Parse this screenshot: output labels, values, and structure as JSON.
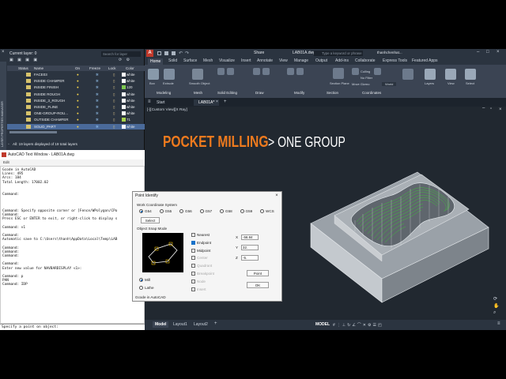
{
  "title_bar": {
    "title": "LAB01A.dwg",
    "share": "Share",
    "search_placeholder": "Type a keyword or phrase",
    "user": "thanhchenhat..."
  },
  "ribbon_tabs": [
    "Home",
    "Solid",
    "Surface",
    "Mesh",
    "Visualize",
    "Insert",
    "Annotate",
    "View",
    "Manage",
    "Output",
    "Add-ins",
    "Collaborate",
    "Express Tools",
    "Featured Apps"
  ],
  "ribbon_groups": [
    "Modeling",
    "Mesh",
    "Solid Editing",
    "Draw",
    "Modify",
    "Section",
    "Coordinates"
  ],
  "ribbon_buttons": [
    "Box",
    "Extrude",
    "Smooth Object",
    "Section Plane",
    "Culling",
    "No Filter",
    "Move Gizmo",
    "Layers",
    "View",
    "Select",
    "World"
  ],
  "file_tabs": {
    "start": "Start",
    "doc": "LAB01A*"
  },
  "viewport_label": "[-][Custom View][X Ray]",
  "layout_tabs": [
    "Model",
    "Layout1",
    "Layout2"
  ],
  "status": {
    "model": "MODEL"
  },
  "layer_panel": {
    "current_layer": "Current layer: 0",
    "search_placeholder": "Search for layer",
    "side_label": "LAYER PROPERTIES MANAGER",
    "columns": [
      "Status",
      "Name",
      "On",
      "Freeze",
      "Lock",
      "Color"
    ],
    "rows": [
      {
        "name": "FACE03",
        "color": "white",
        "swatch": "#ffffff"
      },
      {
        "name": "INSIDE CHAMFER",
        "color": "white",
        "swatch": "#ffffff"
      },
      {
        "name": "INSIDE FINISH",
        "color": "120",
        "swatch": "#7ec850"
      },
      {
        "name": "INSIDE ROUGH",
        "color": "white",
        "swatch": "#ffffff"
      },
      {
        "name": "INSIDE_3_ROUGH",
        "color": "white",
        "swatch": "#ffffff"
      },
      {
        "name": "INSIDE_FLINE",
        "color": "white",
        "swatch": "#ffffff"
      },
      {
        "name": "ONE-GROUP-ROU...",
        "color": "white",
        "swatch": "#ffffff"
      },
      {
        "name": "OUTSIDE CHAMFER",
        "color": "71",
        "swatch": "#a6d34a"
      },
      {
        "name": "SOLID_PART",
        "color": "white",
        "swatch": "#ffffff"
      }
    ],
    "footer": "All: 19 layers displayed of 19 total layers"
  },
  "text_window": {
    "title": "AutoCAD Text Window - LAB01A.dwg",
    "menu": "Edit",
    "lines": [
      "Gcode in AutoCAD",
      "Lines: 495",
      "Arcs: 184",
      "Total Length: 17002.02",
      "",
      "",
      "Command:",
      "",
      "",
      "",
      "Command: Specify opposite corner or [Fence/WPolygon/CPo",
      "Command:",
      "Press ESC or ENTER to exit, or right-click to display s",
      "",
      "Command: v1",
      "",
      "Command:",
      "Automatic save to C:\\Users\\thanh\\AppData\\Local\\Temp\\LAB",
      "",
      "Command:",
      "Command:",
      "Command:",
      "",
      "Command:",
      "Enter new value for NAVBARDISPLAY <1>:",
      "",
      "Command: p",
      "PAN",
      "Command: IDP"
    ],
    "prompt": "Specify a point on object:"
  },
  "dialog": {
    "title": "Point Identify",
    "wcs_label": "Work Coordinate System",
    "wcs_options": [
      "G54",
      "G55",
      "G56",
      "G57",
      "G58",
      "G59",
      "WCS"
    ],
    "wcs_selected": "G54",
    "select_button": "Select",
    "snap_label": "Object Snap Mode",
    "snap_options": [
      {
        "label": "Nearest",
        "checked": false
      },
      {
        "label": "Endpoint",
        "checked": true
      },
      {
        "label": "Midpoint",
        "checked": false
      },
      {
        "label": "Center",
        "checked": false
      },
      {
        "label": "Quadrant",
        "checked": false
      },
      {
        "label": "Breakpoint",
        "checked": false
      },
      {
        "label": "Node",
        "checked": false
      },
      {
        "label": "Insert",
        "checked": false
      }
    ],
    "x_label": "X",
    "x_value": "-56.84",
    "y_label": "Y",
    "y_value": "32.",
    "z_label": "Z",
    "z_value": "-5.",
    "point_button": "Point",
    "ok_button": "OK",
    "mode_options": [
      "Mill",
      "Lathe"
    ],
    "mode_selected": "Mill",
    "footer": "Gcode in AutoCAD"
  },
  "heading": {
    "main": "POCKET MILLING",
    "sub": "> ONE GROUP"
  },
  "colors": {
    "heading_orange": "#ee7a1e",
    "toolpath_green": "#3fbf3a",
    "accent_blue": "#1872c9"
  }
}
